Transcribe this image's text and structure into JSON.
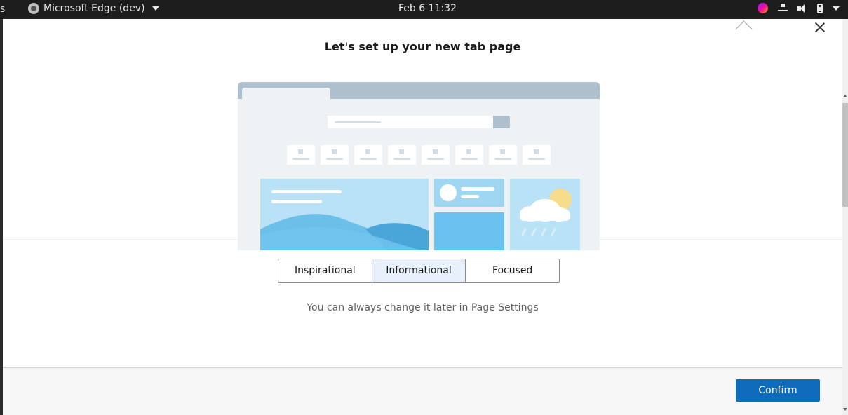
{
  "topbar": {
    "edge_text": "s",
    "app_name": "Microsoft Edge (dev)",
    "clock": "Feb 6  11:32"
  },
  "icons": {
    "app": "edge-app-icon",
    "tray_edge": "edge-dev-icon",
    "network": "network-icon",
    "volume": "volume-icon",
    "battery": "battery-icon",
    "close": "close-icon",
    "collapse": "chevron-up-icon"
  },
  "dialog": {
    "title": "Let's set up your new tab page",
    "layouts": [
      {
        "label": "Inspirational",
        "active": false
      },
      {
        "label": "Informational",
        "active": true
      },
      {
        "label": "Focused",
        "active": false
      }
    ],
    "hint": "You can always change it later in Page Settings",
    "confirm_label": "Confirm"
  },
  "colors": {
    "accent": "#0f6cbd",
    "selected_segment": "#e8f1fb",
    "preview_bar": "#aebfce",
    "preview_sky": "#b9e2f6",
    "preview_blue": "#69c3ee"
  }
}
